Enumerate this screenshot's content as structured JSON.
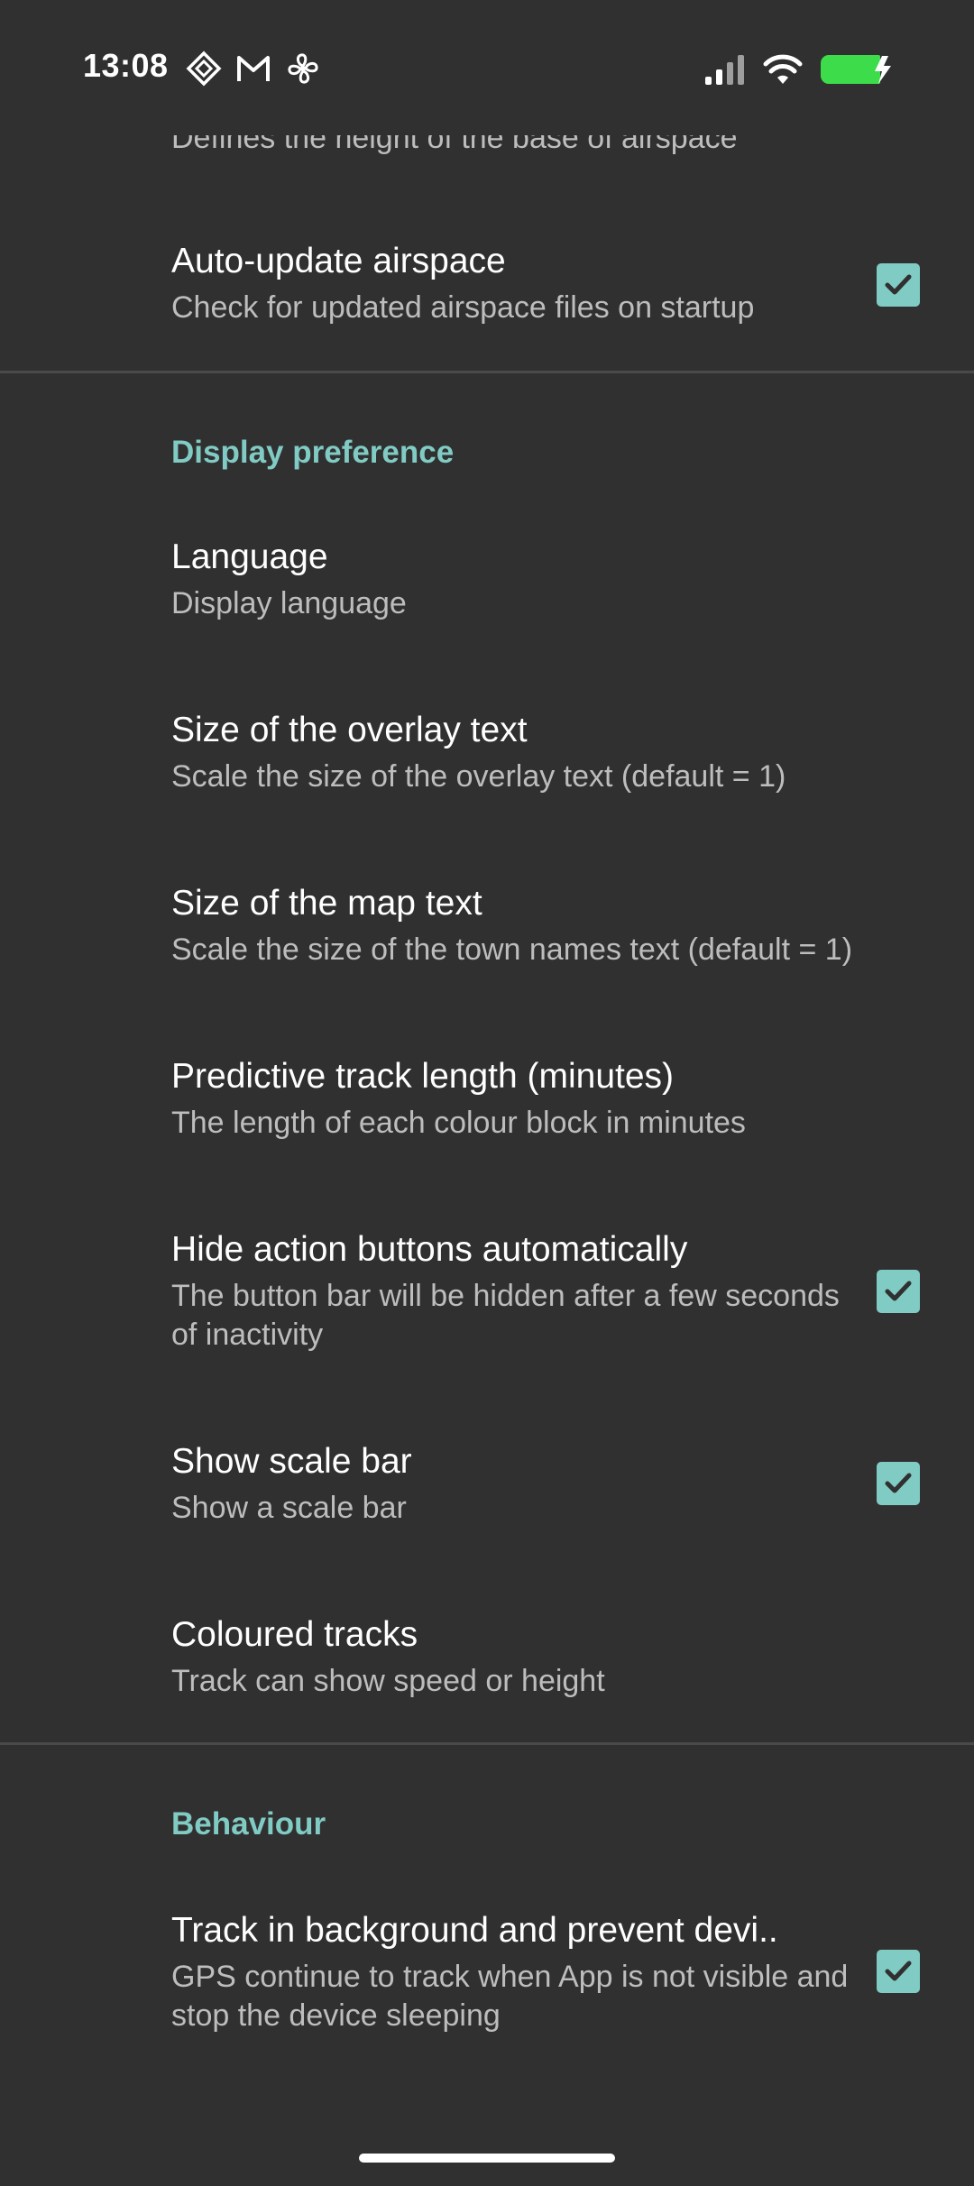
{
  "status_bar": {
    "time": "13:08",
    "left_icons": [
      "diamond-app-icon",
      "gmail-icon",
      "fan-icon"
    ],
    "right_icons": [
      "cell-signal-icon",
      "wifi-icon",
      "battery-charging-icon"
    ],
    "battery_color": "#3ddc4a"
  },
  "colors": {
    "background": "#303030",
    "accent": "#80cbc4",
    "summary_text": "#bdbdbd",
    "divider": "#4a4a4a"
  },
  "top_partial": {
    "summary": "Defines the height of the base of airspace"
  },
  "airspace": {
    "auto_update": {
      "title": "Auto-update airspace",
      "summary": "Check for updated airspace files on startup",
      "checked": true
    }
  },
  "display": {
    "header": "Display preference",
    "items": [
      {
        "title": "Language",
        "summary": "Display language"
      },
      {
        "title": "Size of the overlay text",
        "summary": "Scale the size of the overlay text (default = 1)"
      },
      {
        "title": "Size of the map text",
        "summary": "Scale the size of the town names text (default = 1)"
      },
      {
        "title": "Predictive track length (minutes)",
        "summary": "The length of each colour block in minutes"
      },
      {
        "title": "Hide action buttons automatically",
        "summary": "The button bar will be hidden after a few seconds of inactivity",
        "checked": true
      },
      {
        "title": "Show scale bar",
        "summary": "Show a scale bar",
        "checked": true
      },
      {
        "title": "Coloured tracks",
        "summary": "Track can show speed or height"
      }
    ]
  },
  "behaviour": {
    "header": "Behaviour",
    "items": [
      {
        "title": "Track in background and prevent devi..",
        "summary": "GPS continue to track when App is not visible and stop the device sleeping",
        "checked": true
      }
    ]
  }
}
